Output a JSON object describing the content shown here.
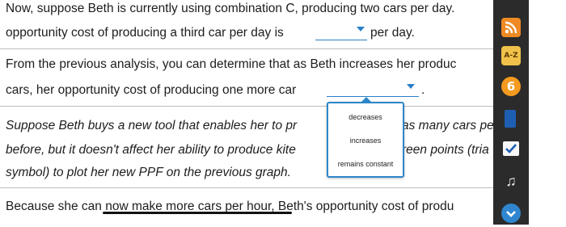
{
  "lines": {
    "l1": "Now, suppose Beth is currently using combination C, producing two cars per day.",
    "l2a": "opportunity cost of producing a third car per day is",
    "l2b": "per day.",
    "l3": "From the previous analysis, you can determine that as Beth increases her produc",
    "l4": "cars, her opportunity cost of producing one more car",
    "l4b": ".",
    "l5a": "Suppose Beth buys a new tool that enables her to pr",
    "l5b": "as many cars pe",
    "l6a": "before, but it doesn't affect her ability to produce kite",
    "l6b": "reen points (tria",
    "l7": "symbol) to plot her new PPF on the previous graph.",
    "l8": "Because she can now make more cars per hour, Beth's opportunity cost of produ"
  },
  "dropdown": {
    "options": [
      "decreases",
      "increases",
      "remains constant"
    ]
  },
  "sidebar": {
    "az_label": "A-Z",
    "coin_label": "6",
    "colors": {
      "background": "#2b2b2b",
      "rss": "#f08a24",
      "az": "#f0c24a",
      "coin": "#f39a1f",
      "book": "#1e5fb3",
      "down": "#2f86cf"
    },
    "icons": [
      "rss-icon",
      "a-z-icon",
      "coin-icon",
      "book-icon",
      "checkmark-icon",
      "music-icon",
      "chevron-down-icon"
    ]
  }
}
